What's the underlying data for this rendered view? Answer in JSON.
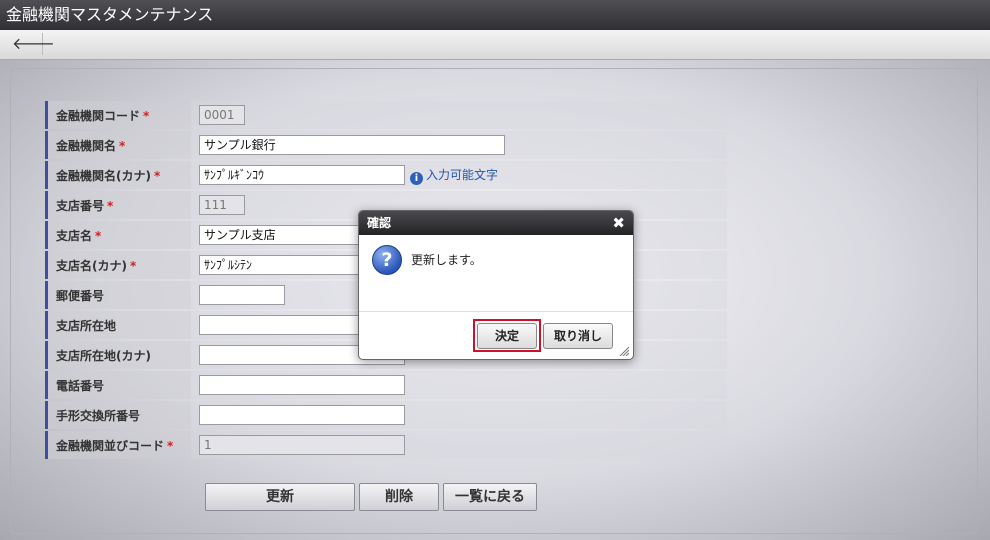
{
  "window": {
    "title": "金融機関マスタメンテナンス"
  },
  "toolbar": {
    "back_icon": "arrow-left-icon",
    "back_glyph": "🡐"
  },
  "form": {
    "fields": [
      {
        "label": "金融機関コード",
        "required": "*",
        "value": "0001"
      },
      {
        "label": "金融機関名",
        "required": "*",
        "value": "サンプル銀行"
      },
      {
        "label": "金融機関名(カナ)",
        "required": "*",
        "value": "ｻﾝﾌﾟﾙｷﾞﾝｺｳ",
        "hint": "入力可能文字"
      },
      {
        "label": "支店番号",
        "required": "*",
        "value": "111"
      },
      {
        "label": "支店名",
        "required": "*",
        "value": "サンプル支店"
      },
      {
        "label": "支店名(カナ)",
        "required": "*",
        "value": "ｻﾝﾌﾟﾙｼﾃﾝ"
      },
      {
        "label": "郵便番号",
        "required": "",
        "value": ""
      },
      {
        "label": "支店所在地",
        "required": "",
        "value": ""
      },
      {
        "label": "支店所在地(カナ)",
        "required": "",
        "value": ""
      },
      {
        "label": "電話番号",
        "required": "",
        "value": ""
      },
      {
        "label": "手形交換所番号",
        "required": "",
        "value": ""
      },
      {
        "label": "金融機関並びコード",
        "required": "*",
        "value": "1"
      }
    ]
  },
  "actions": {
    "update": "更新",
    "delete": "削除",
    "back_to_list": "一覧に戻る"
  },
  "dialog": {
    "title": "確認",
    "close_glyph": "✖",
    "icon_glyph": "?",
    "message": "更新します。",
    "ok": "決定",
    "cancel": "取り消し"
  },
  "colors": {
    "accent_border": "#3e4fa0",
    "highlight": "#d0102a",
    "required": "#cc2222"
  }
}
